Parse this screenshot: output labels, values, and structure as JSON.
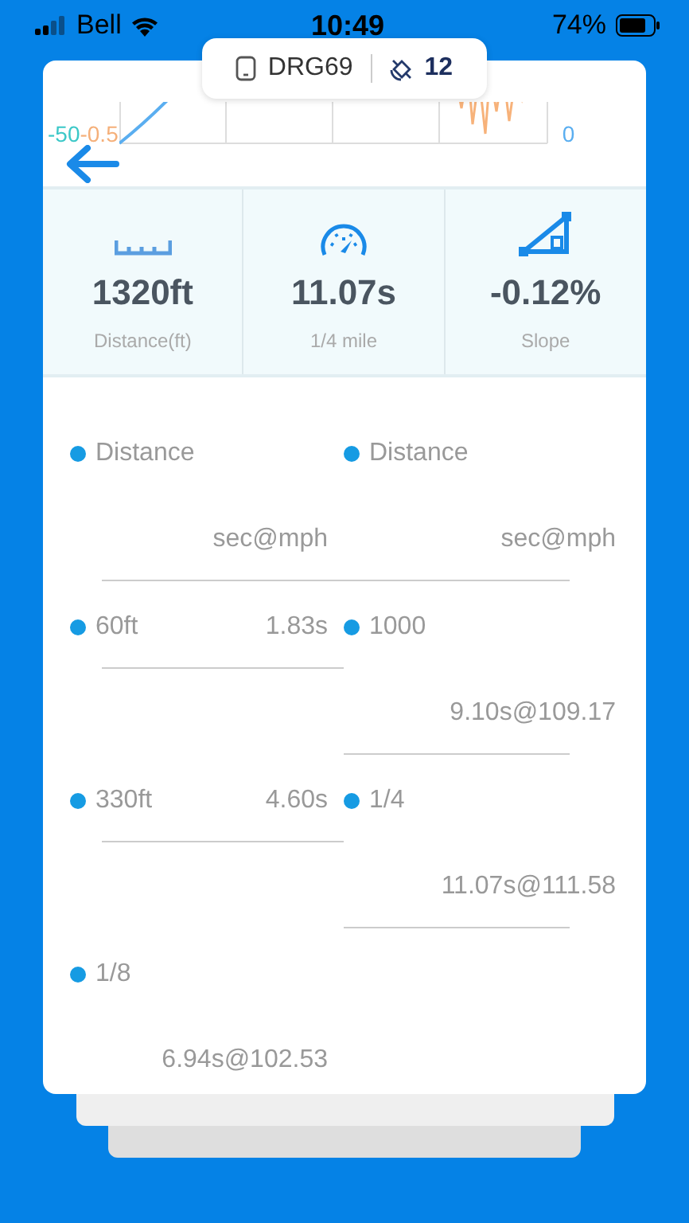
{
  "status_bar": {
    "carrier": "Bell",
    "time": "10:49",
    "battery": "74%"
  },
  "device_pill": {
    "device": "DRG69",
    "satellites": "12"
  },
  "chart": {
    "left_labels": [
      {
        "text": "-50",
        "color": "#3cc8c8"
      },
      {
        "text": "-0.5",
        "color": "#f5b07a"
      }
    ],
    "right_label": {
      "text": "0",
      "color": "#5aaef0"
    }
  },
  "stats": [
    {
      "kind": "distance",
      "value": "1320ft",
      "label": "Distance(ft)"
    },
    {
      "kind": "speed",
      "value": "11.07s",
      "label": "1/4 mile"
    },
    {
      "kind": "slope",
      "value": "-0.12%",
      "label": "Slope"
    }
  ],
  "splits": [
    {
      "kind": "stacked",
      "label": "Distance",
      "value": "sec@mph"
    },
    {
      "kind": "stacked",
      "label": "Distance",
      "value": "sec@mph"
    },
    {
      "kind": "inline",
      "label": "60ft",
      "value": "1.83s"
    },
    {
      "kind": "stacked",
      "label": "1000",
      "value": "9.10s@109.17"
    },
    {
      "kind": "inline",
      "label": "330ft",
      "value": "4.60s"
    },
    {
      "kind": "stacked",
      "label": "1/4",
      "value": "11.07s@111.58"
    },
    {
      "kind": "stacked",
      "label": "1/8",
      "value": "6.94s@102.53"
    }
  ]
}
